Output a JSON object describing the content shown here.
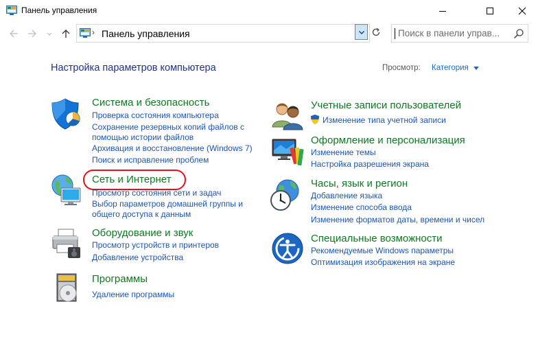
{
  "window": {
    "title": "Панель управления",
    "icon": "control-panel-icon"
  },
  "address": {
    "path": "Панель управления",
    "search_placeholder": "Поиск в панели управ..."
  },
  "main": {
    "heading": "Настройка параметров компьютера",
    "view_by_label": "Просмотр:",
    "view_by_value": "Категория"
  },
  "categories": {
    "system": {
      "title": "Система и безопасность",
      "links": [
        "Проверка состояния компьютера",
        "Сохранение резервных копий файлов с",
        "помощью истории файлов",
        "Архивация и восстановление (Windows 7)",
        "Поиск и исправление проблем"
      ]
    },
    "network": {
      "title": "Сеть и Интернет",
      "links": [
        "Просмотр состояния сети и задач",
        "Выбор параметров домашней группы и",
        "общего доступа к данным"
      ]
    },
    "hardware": {
      "title": "Оборудование и звук",
      "links": [
        "Просмотр устройств и принтеров",
        "Добавление устройства"
      ]
    },
    "programs": {
      "title": "Программы",
      "links": [
        "Удаление программы"
      ]
    },
    "accounts": {
      "title": "Учетные записи пользователей",
      "links": [
        "Изменение типа учетной записи"
      ]
    },
    "appearance": {
      "title": "Оформление и персонализация",
      "links": [
        "Изменение темы",
        "Настройка разрешения экрана"
      ]
    },
    "clock": {
      "title": "Часы, язык и регион",
      "links": [
        "Добавление языка",
        "Изменение способа ввода",
        "Изменение форматов даты, времени и чисел"
      ]
    },
    "ease": {
      "title": "Специальные возможности",
      "links": [
        "Рекомендуемые Windows параметры",
        "Оптимизация изображения на экране"
      ]
    }
  },
  "colors": {
    "category_title": "#0c7a1e",
    "link": "#1c55b3",
    "heading": "#1e3287",
    "highlight": "#e3101b"
  }
}
